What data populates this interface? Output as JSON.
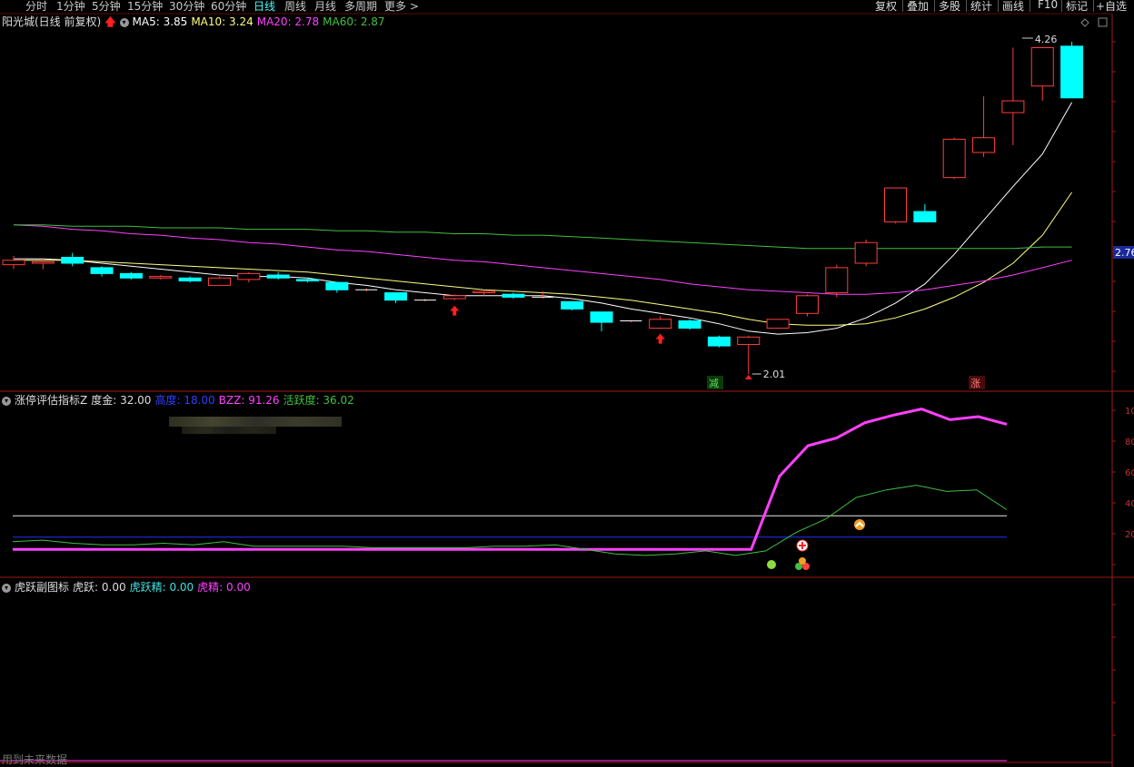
{
  "toolbar": {
    "periods": [
      "分时",
      "1分钟",
      "5分钟",
      "15分钟",
      "30分钟",
      "60分钟",
      "日线",
      "周线",
      "月线",
      "多周期",
      "更多 >"
    ],
    "active_period": "日线",
    "right_items": [
      "复权",
      "叠加",
      "多股",
      "统计",
      "画线",
      "F10",
      "标记",
      "+自选"
    ]
  },
  "main_header": {
    "stock": "阳光城(日线 前复权)",
    "ma5": "MA5: 3.85",
    "ma10": "MA10: 3.24",
    "ma20": "MA20: 2.78",
    "ma60": "MA60: 2.87"
  },
  "sub1_header": {
    "name": "涨停评估指标Z",
    "v1": "度金: 32.00",
    "v2": "高度: 18.00",
    "v3": "BZZ: 91.26",
    "v4": "活跃度: 36.02"
  },
  "sub2_header": {
    "name": "虎跃副图标",
    "v1": "虎跃: 0.00",
    "v2": "虎跃精: 0.00",
    "v3": "虎精: 0.00"
  },
  "annotations": {
    "high_price": "4.26",
    "low_price": "2.01",
    "price_tag": "2.76",
    "mark_down": "减",
    "mark_up": "涨"
  },
  "sub1_axis": [
    "10",
    "80",
    "60",
    "40",
    "20"
  ],
  "footer": "用到未来数据",
  "colors": {
    "bg": "#000000",
    "up": "#ff3d3d",
    "down": "#00ffff",
    "ma5": "#ffffff",
    "ma10": "#ffff80",
    "ma20": "#ff40ff",
    "ma60": "#40c040",
    "grid": "#8b0000"
  },
  "chart_data": {
    "type": "candlestick",
    "series_ohlc": [
      [
        2.75,
        2.81,
        2.72,
        2.78
      ],
      [
        2.76,
        2.79,
        2.72,
        2.77
      ],
      [
        2.8,
        2.83,
        2.74,
        2.76
      ],
      [
        2.73,
        2.74,
        2.67,
        2.69
      ],
      [
        2.69,
        2.7,
        2.65,
        2.66
      ],
      [
        2.66,
        2.68,
        2.65,
        2.67
      ],
      [
        2.66,
        2.67,
        2.63,
        2.64
      ],
      [
        2.61,
        2.67,
        2.61,
        2.66
      ],
      [
        2.65,
        2.7,
        2.63,
        2.69
      ],
      [
        2.68,
        2.7,
        2.65,
        2.66
      ],
      [
        2.65,
        2.66,
        2.63,
        2.64
      ],
      [
        2.63,
        2.63,
        2.56,
        2.58
      ],
      [
        2.58,
        2.59,
        2.57,
        2.58
      ],
      [
        2.56,
        2.56,
        2.49,
        2.51
      ],
      [
        2.51,
        2.52,
        2.5,
        2.51
      ],
      [
        2.52,
        2.55,
        2.51,
        2.54
      ],
      [
        2.56,
        2.58,
        2.54,
        2.57
      ],
      [
        2.55,
        2.56,
        2.52,
        2.53
      ],
      [
        2.53,
        2.57,
        2.52,
        2.53
      ],
      [
        2.5,
        2.5,
        2.44,
        2.45
      ],
      [
        2.43,
        2.43,
        2.3,
        2.36
      ],
      [
        2.37,
        2.37,
        2.36,
        2.37
      ],
      [
        2.32,
        2.4,
        2.32,
        2.38
      ],
      [
        2.37,
        2.38,
        2.31,
        2.32
      ],
      [
        2.26,
        2.27,
        2.19,
        2.2
      ],
      [
        2.21,
        2.27,
        2.01,
        2.26
      ],
      [
        2.32,
        2.38,
        2.32,
        2.38
      ],
      [
        2.42,
        2.55,
        2.4,
        2.54
      ],
      [
        2.56,
        2.75,
        2.53,
        2.73
      ],
      [
        2.76,
        2.92,
        2.74,
        2.9
      ],
      [
        3.04,
        3.27,
        3.03,
        3.27
      ],
      [
        3.11,
        3.16,
        3.04,
        3.04
      ],
      [
        3.34,
        3.61,
        3.33,
        3.6
      ],
      [
        3.51,
        3.89,
        3.48,
        3.61
      ],
      [
        3.78,
        4.22,
        3.56,
        3.86
      ],
      [
        3.96,
        4.22,
        3.86,
        4.22
      ],
      [
        4.23,
        4.26,
        3.88,
        3.88
      ]
    ],
    "ma_series": [
      {
        "name": "MA5",
        "values": [
          2.79,
          2.79,
          2.78,
          2.76,
          2.74,
          2.72,
          2.7,
          2.68,
          2.67,
          2.67,
          2.66,
          2.63,
          2.61,
          2.58,
          2.56,
          2.54,
          2.54,
          2.54,
          2.54,
          2.52,
          2.49,
          2.45,
          2.42,
          2.39,
          2.35,
          2.3,
          2.28,
          2.29,
          2.32,
          2.39,
          2.49,
          2.62,
          2.82,
          3.05,
          3.28,
          3.5,
          3.85
        ]
      },
      {
        "name": "MA10",
        "values": [
          2.78,
          2.78,
          2.78,
          2.77,
          2.76,
          2.75,
          2.74,
          2.73,
          2.72,
          2.71,
          2.7,
          2.68,
          2.66,
          2.64,
          2.62,
          2.6,
          2.58,
          2.57,
          2.56,
          2.55,
          2.53,
          2.51,
          2.48,
          2.45,
          2.42,
          2.38,
          2.35,
          2.34,
          2.34,
          2.35,
          2.39,
          2.45,
          2.53,
          2.63,
          2.76,
          2.95,
          3.24
        ]
      },
      {
        "name": "MA20",
        "values": [
          3.02,
          3.01,
          2.99,
          2.98,
          2.96,
          2.95,
          2.93,
          2.92,
          2.9,
          2.89,
          2.87,
          2.85,
          2.84,
          2.82,
          2.8,
          2.78,
          2.77,
          2.75,
          2.73,
          2.71,
          2.69,
          2.67,
          2.65,
          2.62,
          2.6,
          2.58,
          2.57,
          2.56,
          2.55,
          2.55,
          2.56,
          2.58,
          2.61,
          2.64,
          2.68,
          2.73,
          2.78
        ]
      },
      {
        "name": "MA60",
        "values": [
          3.02,
          3.02,
          3.01,
          3.01,
          3.01,
          3.0,
          3.0,
          3.0,
          2.99,
          2.99,
          2.99,
          2.98,
          2.98,
          2.97,
          2.97,
          2.96,
          2.96,
          2.95,
          2.95,
          2.94,
          2.93,
          2.92,
          2.91,
          2.9,
          2.89,
          2.88,
          2.87,
          2.86,
          2.86,
          2.86,
          2.86,
          2.86,
          2.86,
          2.86,
          2.86,
          2.87,
          2.87
        ]
      }
    ],
    "sub1_series": [
      {
        "name": "BZZ",
        "values": [
          10,
          10,
          10,
          10,
          10,
          10,
          10,
          10,
          10,
          10,
          10,
          10,
          10,
          10,
          10,
          10,
          10,
          10,
          10,
          10,
          10,
          10,
          10,
          10,
          10,
          10,
          10,
          58,
          78,
          83,
          93,
          98,
          102,
          95,
          97,
          92
        ]
      },
      {
        "name": "活跃度",
        "values": [
          15,
          16,
          14,
          13,
          13,
          14,
          13,
          15,
          12,
          12,
          12,
          12,
          11,
          11,
          11,
          11,
          12,
          12,
          13,
          10,
          7,
          6,
          7,
          9,
          6,
          9,
          21,
          30,
          44,
          49,
          52,
          48,
          49,
          36
        ]
      },
      {
        "name": "高度",
        "values": [
          18
        ]
      },
      {
        "name": "度金",
        "values": [
          32
        ]
      }
    ]
  }
}
